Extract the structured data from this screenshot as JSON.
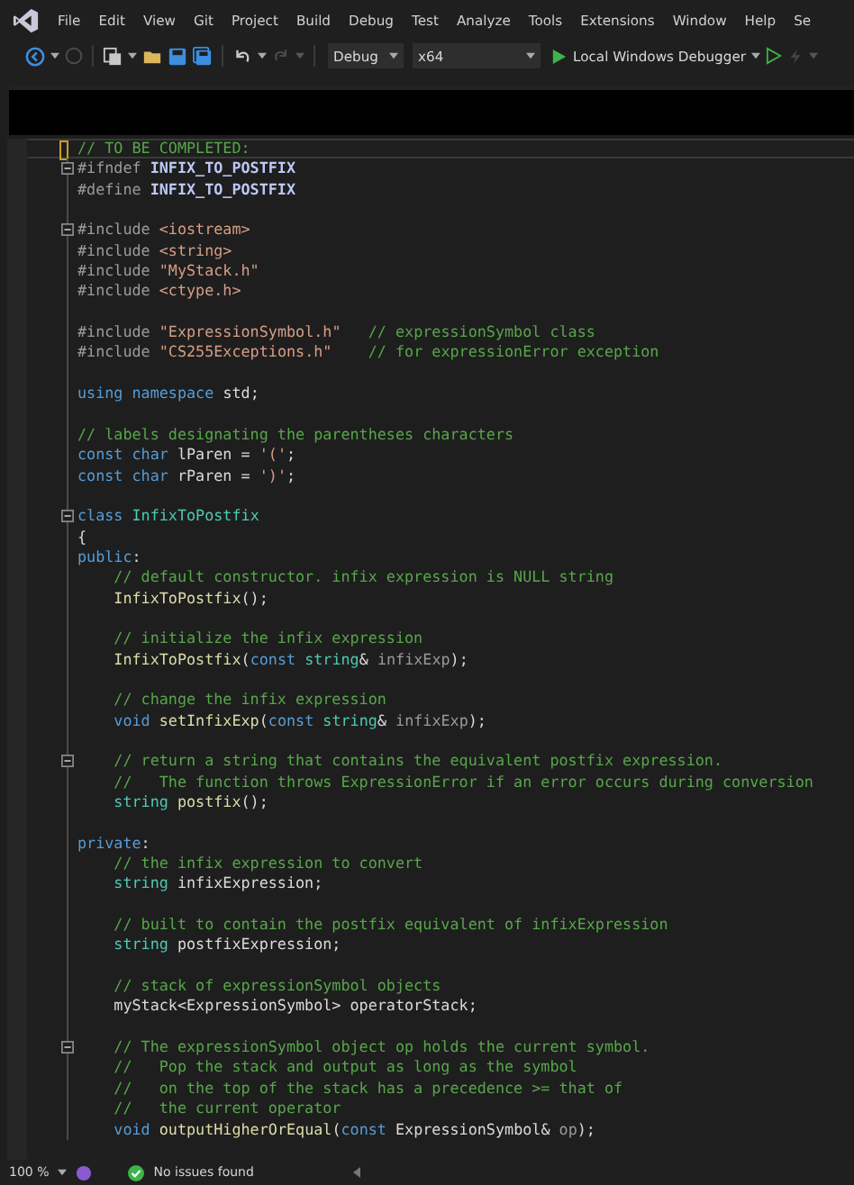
{
  "menu": [
    "File",
    "Edit",
    "View",
    "Git",
    "Project",
    "Build",
    "Debug",
    "Test",
    "Analyze",
    "Tools",
    "Extensions",
    "Window",
    "Help",
    "Se"
  ],
  "toolbar": {
    "configuration": "Debug",
    "platform": "x64",
    "run_label": "Local Windows Debugger"
  },
  "editor": {
    "lines": [
      {
        "fold": false,
        "current": true,
        "segments": [
          {
            "kind": "comment",
            "text": "// TO BE COMPLETED:"
          }
        ]
      },
      {
        "fold": true,
        "current": false,
        "segments": [
          {
            "kind": "pre",
            "text": "#ifndef "
          },
          {
            "kind": "macro",
            "text": "INFIX_TO_POSTFIX"
          }
        ]
      },
      {
        "fold": false,
        "current": false,
        "segments": [
          {
            "kind": "pre",
            "text": "#define "
          },
          {
            "kind": "macro",
            "text": "INFIX_TO_POSTFIX"
          }
        ]
      },
      {
        "fold": false,
        "current": false
      },
      {
        "fold": true,
        "current": false,
        "segments": [
          {
            "kind": "pre",
            "text": "#include "
          },
          {
            "kind": "string",
            "text": "<iostream>"
          }
        ]
      },
      {
        "fold": false,
        "current": false,
        "segments": [
          {
            "kind": "pre",
            "text": "#include "
          },
          {
            "kind": "string",
            "text": "<string>"
          }
        ]
      },
      {
        "fold": false,
        "current": false,
        "segments": [
          {
            "kind": "pre",
            "text": "#include "
          },
          {
            "kind": "string",
            "text": "\"MyStack.h\""
          }
        ]
      },
      {
        "fold": false,
        "current": false,
        "segments": [
          {
            "kind": "pre",
            "text": "#include "
          },
          {
            "kind": "string",
            "text": "<ctype.h>"
          }
        ]
      },
      {
        "fold": false,
        "current": false
      },
      {
        "fold": false,
        "current": false,
        "segments": [
          {
            "kind": "pre",
            "text": "#include "
          },
          {
            "kind": "string",
            "text": "\"ExpressionSymbol.h\""
          },
          {
            "kind": "comment",
            "text": "   // expressionSymbol class"
          }
        ]
      },
      {
        "fold": false,
        "current": false,
        "segments": [
          {
            "kind": "pre",
            "text": "#include "
          },
          {
            "kind": "string",
            "text": "\"CS255Exceptions.h\""
          },
          {
            "kind": "comment",
            "text": "    // for expressionError exception"
          }
        ]
      },
      {
        "fold": false,
        "current": false
      },
      {
        "fold": false,
        "current": false,
        "segments": [
          {
            "kind": "keyword",
            "text": "using namespace "
          },
          {
            "kind": "plain",
            "text": "std;"
          }
        ]
      },
      {
        "fold": false,
        "current": false
      },
      {
        "fold": false,
        "current": false,
        "segments": [
          {
            "kind": "comment",
            "text": "// labels designating the parentheses characters"
          }
        ]
      },
      {
        "fold": false,
        "current": false,
        "segments": [
          {
            "kind": "keyword",
            "text": "const char "
          },
          {
            "kind": "plain",
            "text": "lParen = "
          },
          {
            "kind": "string",
            "text": "'('"
          },
          {
            "kind": "plain",
            "text": ";"
          }
        ]
      },
      {
        "fold": false,
        "current": false,
        "segments": [
          {
            "kind": "keyword",
            "text": "const char "
          },
          {
            "kind": "plain",
            "text": "rParen = "
          },
          {
            "kind": "string",
            "text": "')'"
          },
          {
            "kind": "plain",
            "text": ";"
          }
        ]
      },
      {
        "fold": false,
        "current": false
      },
      {
        "fold": true,
        "current": false,
        "segments": [
          {
            "kind": "keyword",
            "text": "class "
          },
          {
            "kind": "type",
            "text": "InfixToPostfix"
          }
        ]
      },
      {
        "fold": false,
        "current": false,
        "segments": [
          {
            "kind": "plain",
            "text": "{"
          }
        ]
      },
      {
        "fold": false,
        "current": false,
        "segments": [
          {
            "kind": "keyword",
            "text": "public"
          },
          {
            "kind": "plain",
            "text": ":"
          }
        ]
      },
      {
        "fold": false,
        "current": false,
        "segments": [
          {
            "kind": "comment",
            "text": "    // default constructor. infix expression is NULL string"
          }
        ]
      },
      {
        "fold": false,
        "current": false,
        "segments": [
          {
            "kind": "func",
            "text": "    InfixToPostfix"
          },
          {
            "kind": "plain",
            "text": "();"
          }
        ]
      },
      {
        "fold": false,
        "current": false
      },
      {
        "fold": false,
        "current": false,
        "segments": [
          {
            "kind": "comment",
            "text": "    // initialize the infix expression"
          }
        ]
      },
      {
        "fold": false,
        "current": false,
        "segments": [
          {
            "kind": "func",
            "text": "    InfixToPostfix"
          },
          {
            "kind": "plain",
            "text": "("
          },
          {
            "kind": "keyword",
            "text": "const "
          },
          {
            "kind": "type",
            "text": "string"
          },
          {
            "kind": "plain",
            "text": "& "
          },
          {
            "kind": "param",
            "text": "infixExp"
          },
          {
            "kind": "plain",
            "text": ");"
          }
        ]
      },
      {
        "fold": false,
        "current": false
      },
      {
        "fold": false,
        "current": false,
        "segments": [
          {
            "kind": "comment",
            "text": "    // change the infix expression"
          }
        ]
      },
      {
        "fold": false,
        "current": false,
        "segments": [
          {
            "kind": "keyword",
            "text": "    void "
          },
          {
            "kind": "func",
            "text": "setInfixExp"
          },
          {
            "kind": "plain",
            "text": "("
          },
          {
            "kind": "keyword",
            "text": "const "
          },
          {
            "kind": "type",
            "text": "string"
          },
          {
            "kind": "plain",
            "text": "& "
          },
          {
            "kind": "param",
            "text": "infixExp"
          },
          {
            "kind": "plain",
            "text": ");"
          }
        ]
      },
      {
        "fold": false,
        "current": false
      },
      {
        "fold": true,
        "current": false,
        "segments": [
          {
            "kind": "comment",
            "text": "    // return a string that contains the equivalent postfix expression."
          }
        ]
      },
      {
        "fold": false,
        "current": false,
        "segments": [
          {
            "kind": "comment",
            "text": "    //   The function throws ExpressionError if an error occurs during conversion"
          }
        ]
      },
      {
        "fold": false,
        "current": false,
        "segments": [
          {
            "kind": "type",
            "text": "    string "
          },
          {
            "kind": "func",
            "text": "postfix"
          },
          {
            "kind": "plain",
            "text": "();"
          }
        ]
      },
      {
        "fold": false,
        "current": false
      },
      {
        "fold": false,
        "current": false,
        "segments": [
          {
            "kind": "keyword",
            "text": "private"
          },
          {
            "kind": "plain",
            "text": ":"
          }
        ]
      },
      {
        "fold": false,
        "current": false,
        "segments": [
          {
            "kind": "comment",
            "text": "    // the infix expression to convert"
          }
        ]
      },
      {
        "fold": false,
        "current": false,
        "segments": [
          {
            "kind": "type",
            "text": "    string "
          },
          {
            "kind": "plain",
            "text": "infixExpression;"
          }
        ]
      },
      {
        "fold": false,
        "current": false
      },
      {
        "fold": false,
        "current": false,
        "segments": [
          {
            "kind": "comment",
            "text": "    // built to contain the postfix equivalent of infixExpression"
          }
        ]
      },
      {
        "fold": false,
        "current": false,
        "segments": [
          {
            "kind": "type",
            "text": "    string "
          },
          {
            "kind": "plain",
            "text": "postfixExpression;"
          }
        ]
      },
      {
        "fold": false,
        "current": false
      },
      {
        "fold": false,
        "current": false,
        "segments": [
          {
            "kind": "comment",
            "text": "    // stack of expressionSymbol objects"
          }
        ]
      },
      {
        "fold": false,
        "current": false,
        "segments": [
          {
            "kind": "plain",
            "text": "    myStack<ExpressionSymbol> operatorStack;"
          }
        ]
      },
      {
        "fold": false,
        "current": false
      },
      {
        "fold": true,
        "current": false,
        "segments": [
          {
            "kind": "comment",
            "text": "    // The expressionSymbol object op holds the current symbol."
          }
        ]
      },
      {
        "fold": false,
        "current": false,
        "segments": [
          {
            "kind": "comment",
            "text": "    //   Pop the stack and output as long as the symbol"
          }
        ]
      },
      {
        "fold": false,
        "current": false,
        "segments": [
          {
            "kind": "comment",
            "text": "    //   on the top of the stack has a precedence >= that of"
          }
        ]
      },
      {
        "fold": false,
        "current": false,
        "segments": [
          {
            "kind": "comment",
            "text": "    //   the current operator"
          }
        ]
      },
      {
        "fold": false,
        "current": false,
        "segments": [
          {
            "kind": "keyword",
            "text": "    void "
          },
          {
            "kind": "func",
            "text": "outputHigherOrEqual"
          },
          {
            "kind": "plain",
            "text": "("
          },
          {
            "kind": "keyword",
            "text": "const "
          },
          {
            "kind": "plain",
            "text": "ExpressionSymbol& "
          },
          {
            "kind": "param",
            "text": "op"
          },
          {
            "kind": "plain",
            "text": ");"
          }
        ]
      }
    ]
  },
  "status_bar": {
    "zoom": "100 %",
    "issues": "No issues found"
  }
}
